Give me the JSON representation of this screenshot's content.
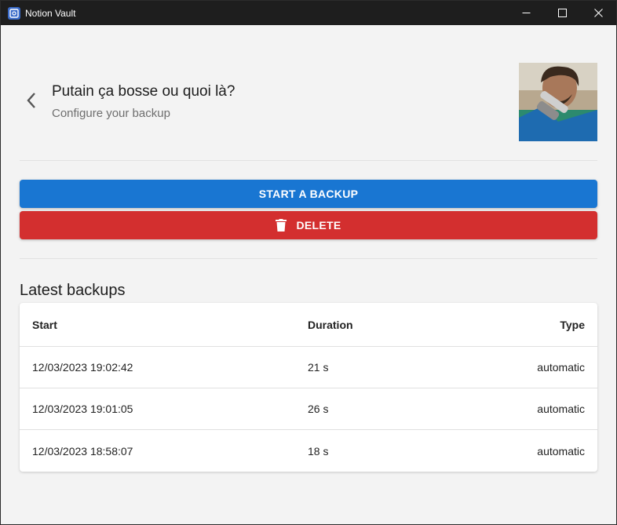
{
  "window": {
    "title": "Notion Vault"
  },
  "header": {
    "title": "Putain ça bosse ou quoi là?",
    "subtitle": "Configure your backup"
  },
  "actions": {
    "start_label": "START A BACKUP",
    "delete_label": "DELETE"
  },
  "backups": {
    "title": "Latest backups",
    "columns": {
      "start": "Start",
      "duration": "Duration",
      "type": "Type"
    },
    "rows": [
      {
        "start": "12/03/2023 19:02:42",
        "duration": "21 s",
        "type": "automatic"
      },
      {
        "start": "12/03/2023 19:01:05",
        "duration": "26 s",
        "type": "automatic"
      },
      {
        "start": "12/03/2023 18:58:07",
        "duration": "18 s",
        "type": "automatic"
      }
    ]
  },
  "colors": {
    "primary": "#1976d2",
    "danger": "#d32f2f",
    "background": "#f3f3f3"
  },
  "icons": {
    "app": "vault-icon",
    "back": "chevron-left-icon",
    "delete": "trash-icon",
    "minimize": "minimize-icon",
    "maximize": "maximize-icon",
    "close": "close-icon"
  }
}
